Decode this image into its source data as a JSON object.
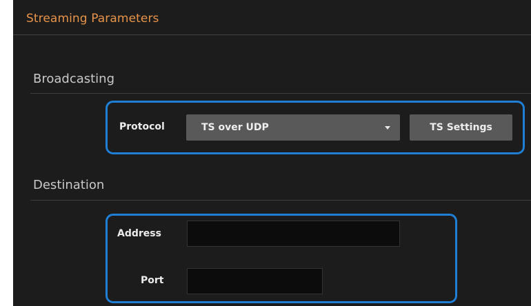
{
  "panel": {
    "title": "Streaming Parameters",
    "title_color": "#e8944a",
    "highlight_color": "#1f7fd4"
  },
  "broadcasting": {
    "heading": "Broadcasting",
    "protocol_label": "Protocol",
    "protocol_selected": "TS over UDP",
    "ts_settings_label": "TS Settings"
  },
  "destination": {
    "heading": "Destination",
    "address_label": "Address",
    "address_value": "",
    "port_label": "Port",
    "port_value": ""
  }
}
